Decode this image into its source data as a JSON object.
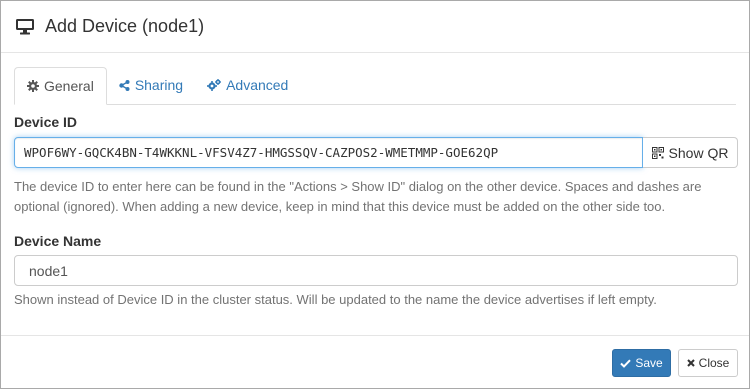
{
  "dialog": {
    "title": "Add Device (node1)",
    "title_icon": "desktop-icon"
  },
  "tabs": [
    {
      "label": "General",
      "icon": "gear-icon",
      "active": true
    },
    {
      "label": "Sharing",
      "icon": "share-icon",
      "active": false
    },
    {
      "label": "Advanced",
      "icon": "gears-icon",
      "active": false
    }
  ],
  "device_id": {
    "label": "Device ID",
    "value": "WPOF6WY-GQCK4BN-T4WKKNL-VFSV4Z7-HMGSSQV-CAZPOS2-WMETMMP-GOE62QP",
    "show_qr_label": "Show QR",
    "help": "The device ID to enter here can be found in the \"Actions > Show ID\" dialog on the other device. Spaces and dashes are optional (ignored). When adding a new device, keep in mind that this device must be added on the other side too."
  },
  "device_name": {
    "label": "Device Name",
    "value": "node1",
    "help": "Shown instead of Device ID in the cluster status. Will be updated to the name the device advertises if left empty."
  },
  "footer": {
    "save_label": "Save",
    "close_label": "Close"
  },
  "colors": {
    "primary": "#337ab7",
    "link": "#337ab7",
    "focus_border": "#66afe9"
  }
}
